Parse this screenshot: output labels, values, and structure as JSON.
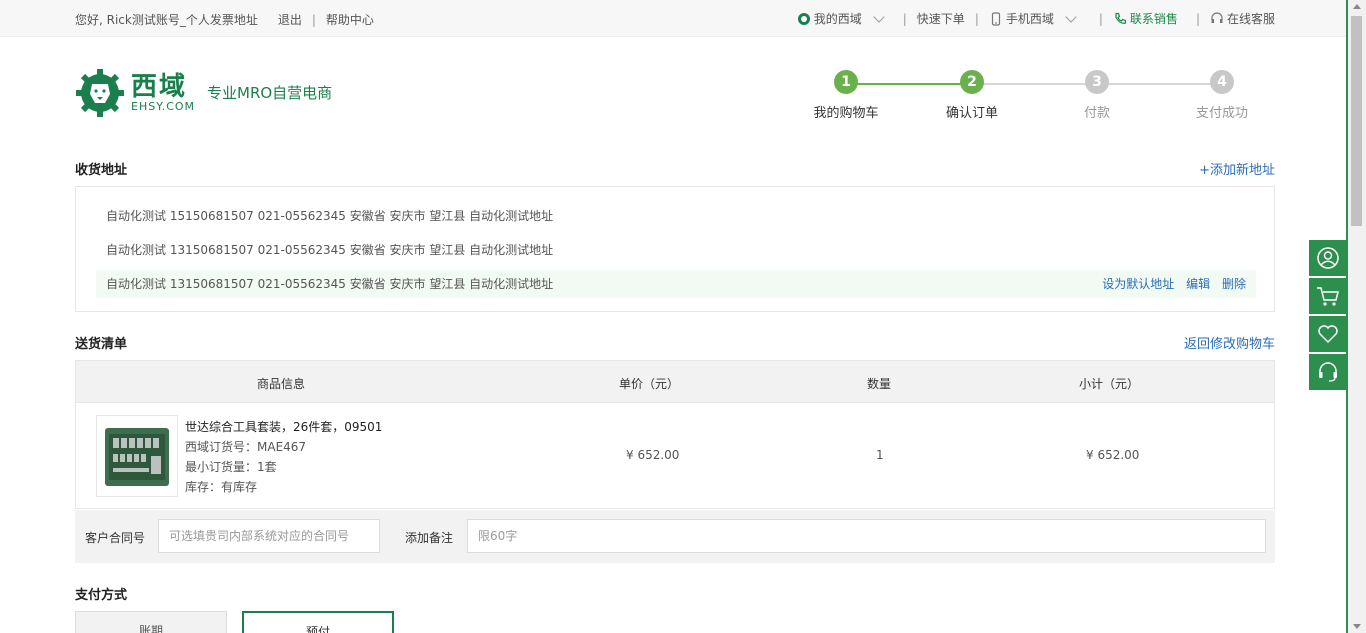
{
  "topbar": {
    "greeting": "您好, Rick测试账号_个人发票地址",
    "logout": "退出",
    "help": "帮助中心",
    "my_ehsy": "我的西域",
    "quick_order": "快速下单",
    "mobile": "手机西域",
    "contact_sales": "联系销售",
    "online_service": "在线客服"
  },
  "header": {
    "logo_cn": "西域",
    "logo_en": "EHSY.COM",
    "slogan": "专业MRO自营电商"
  },
  "steps": [
    {
      "num": "1",
      "label": "我的购物车",
      "state": "done"
    },
    {
      "num": "2",
      "label": "确认订单",
      "state": "current"
    },
    {
      "num": "3",
      "label": "付款",
      "state": "todo"
    },
    {
      "num": "4",
      "label": "支付成功",
      "state": "todo"
    }
  ],
  "colors": {
    "brand": "#1a7f4c",
    "step_done": "#6ab04c",
    "step_todo": "#c8c8c8",
    "link": "#2a6db8"
  },
  "address": {
    "title": "收货地址",
    "add_link": "+添加新地址",
    "rows": [
      {
        "text": "自动化测试   15150681507 021-05562345 安徽省 安庆市 望江县 自动化测试地址"
      },
      {
        "text": "自动化测试   13150681507 021-05562345 安徽省 安庆市 望江县 自动化测试地址"
      },
      {
        "text": "自动化测试   13150681507 021-05562345 安徽省 安庆市 望江县 自动化测试地址"
      }
    ],
    "actions": {
      "set_default": "设为默认地址",
      "edit": "编辑",
      "delete": "删除"
    }
  },
  "delivery": {
    "title": "送货清单",
    "back_link": "返回修改购物车",
    "headers": {
      "info": "商品信息",
      "price": "单价（元）",
      "qty": "数量",
      "subtotal": "小计（元）"
    },
    "item": {
      "name": "世达综合工具套装，26件套，09501",
      "sku": "西域订货号：MAE467",
      "moq": "最小订货量：1套",
      "stock": "库存：有库存",
      "price": "¥ 652.00",
      "qty": "1",
      "subtotal": "¥ 652.00"
    },
    "contract_label": "客户合同号",
    "contract_placeholder": "可选填贵司内部系统对应的合同号",
    "remark_label": "添加备注",
    "remark_placeholder": "限60字"
  },
  "payment": {
    "title": "支付方式",
    "options": [
      "账期",
      "预付"
    ]
  },
  "float_bar": [
    "user-icon",
    "cart-icon",
    "heart-icon",
    "headset-icon"
  ]
}
